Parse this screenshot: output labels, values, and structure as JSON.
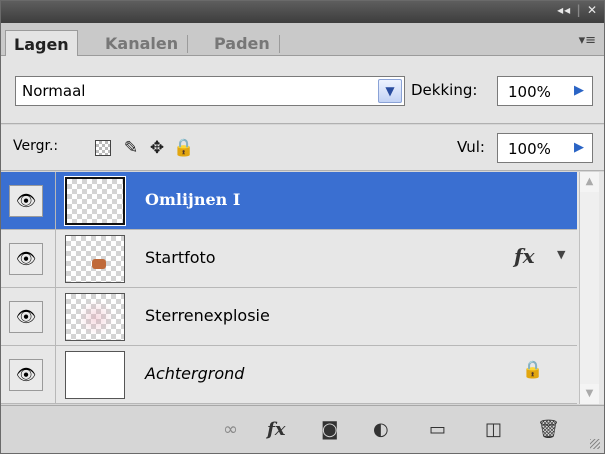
{
  "titlebar": {
    "collapse": "◂◂",
    "close": "✕"
  },
  "tabs": [
    {
      "label": "Lagen"
    },
    {
      "label": "Kanalen"
    },
    {
      "label": "Paden"
    }
  ],
  "tab_menu_icon": "▾≡",
  "blend_mode": {
    "value": "Normaal"
  },
  "opacity": {
    "label": "Dekking:",
    "value": "100%"
  },
  "lock": {
    "label": "Vergr.:",
    "icons": [
      "lock-transparent-icon",
      "lock-brush-icon",
      "lock-move-icon",
      "lock-all-icon"
    ]
  },
  "fill": {
    "label": "Vul:",
    "value": "100%"
  },
  "layers": [
    {
      "name": "Omlijnen I",
      "selected": true,
      "visible": true
    },
    {
      "name": "Startfoto",
      "selected": false,
      "visible": true,
      "fx": "fx"
    },
    {
      "name": "Sterrenexplosie",
      "selected": false,
      "visible": true
    },
    {
      "name": "Achtergrond",
      "selected": false,
      "visible": true,
      "locked": true
    }
  ],
  "bottom_icons": [
    "link-layers-icon",
    "fx-icon",
    "mask-icon",
    "adjustment-icon",
    "group-folder-icon",
    "new-layer-icon",
    "trash-icon"
  ],
  "bottom_fx_label": "fx",
  "colors": {
    "selection": "#3a6fd1",
    "panel": "#d6d6d6"
  }
}
